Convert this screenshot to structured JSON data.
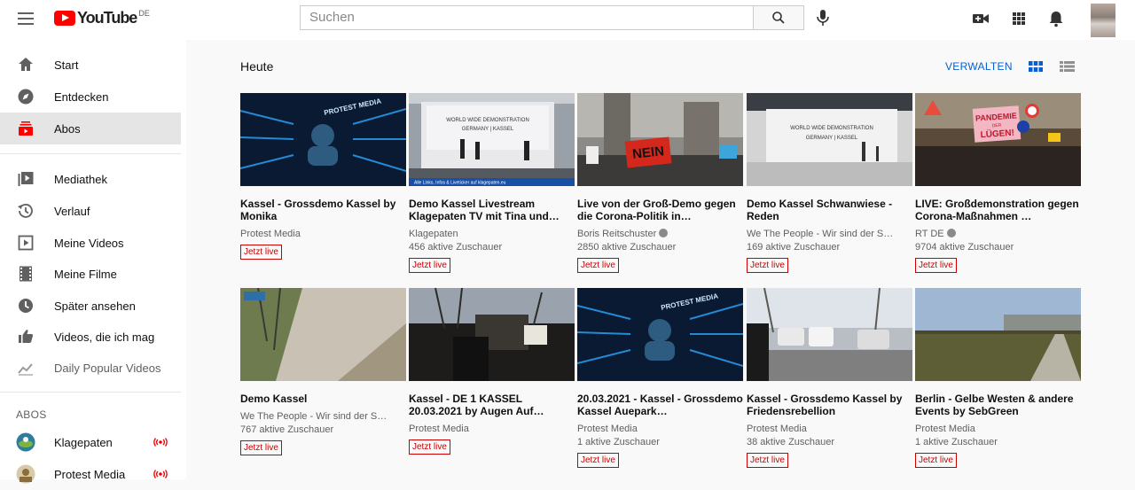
{
  "header": {
    "logo_text": "YouTube",
    "logo_country": "DE",
    "search_placeholder": "Suchen"
  },
  "sidebar": {
    "items": [
      {
        "label": "Start",
        "icon": "home-icon"
      },
      {
        "label": "Entdecken",
        "icon": "compass-icon"
      },
      {
        "label": "Abos",
        "icon": "subscriptions-icon",
        "active": true
      },
      {
        "label": "Mediathek",
        "icon": "library-icon"
      },
      {
        "label": "Verlauf",
        "icon": "history-icon"
      },
      {
        "label": "Meine Videos",
        "icon": "my-videos-icon"
      },
      {
        "label": "Meine Filme",
        "icon": "film-icon"
      },
      {
        "label": "Später ansehen",
        "icon": "watch-later-icon"
      },
      {
        "label": "Videos, die ich mag",
        "icon": "thumbs-up-icon"
      },
      {
        "label": "Daily Popular Videos",
        "icon": "trending-icon"
      }
    ],
    "abos_title": "ABOS",
    "channels": [
      {
        "name": "Klagepaten",
        "live": true
      },
      {
        "name": "Protest Media",
        "live": true
      }
    ]
  },
  "main": {
    "section_title": "Heute",
    "manage_label": "VERWALTEN",
    "live_badge": "Jetzt live",
    "videos": [
      {
        "title": "Kassel - Grossdemo Kassel by Monika",
        "channel": "Protest Media",
        "viewers": "",
        "verified": false,
        "thumb": "protest-media"
      },
      {
        "title": "Demo Kassel Livestream Klagepaten TV mit Tina und…",
        "channel": "Klagepaten",
        "viewers": "456 aktive Zuschauer",
        "verified": false,
        "thumb": "stage"
      },
      {
        "title": "Live von der Groß-Demo gegen die Corona-Politik in…",
        "channel": "Boris Reitschuster",
        "viewers": "2850 aktive Zuschauer",
        "verified": true,
        "thumb": "crowd-nein"
      },
      {
        "title": "Demo Kassel Schwanwiese - Reden",
        "channel": "We The People - Wir sind der S…",
        "viewers": "169 aktive Zuschauer",
        "verified": false,
        "thumb": "stage2"
      },
      {
        "title": "LIVE: Großdemonstration gegen Corona-Maßnahmen …",
        "channel": "RT DE",
        "viewers": "9704 aktive Zuschauer",
        "verified": true,
        "thumb": "pandemie"
      },
      {
        "title": "Demo Kassel",
        "channel": "We The People - Wir sind der S…",
        "viewers": "767 aktive Zuschauer",
        "verified": false,
        "thumb": "park"
      },
      {
        "title": "Kassel - DE 1 KASSEL 20.03.2021 by Augen Auf…",
        "channel": "Protest Media",
        "viewers": "",
        "verified": false,
        "thumb": "dark-crowd"
      },
      {
        "title": "20.03.2021 - Kassel - Grossdemo Kassel Auepark…",
        "channel": "Protest Media",
        "viewers": "1 aktive Zuschauer",
        "verified": false,
        "thumb": "protest-media"
      },
      {
        "title": "Kassel - Grossdemo Kassel by Friedensrebellion",
        "channel": "Protest Media",
        "viewers": "38 aktive Zuschauer",
        "verified": false,
        "thumb": "street-cars"
      },
      {
        "title": "Berlin - Gelbe Westen & andere Events by SebGreen",
        "channel": "Protest Media",
        "viewers": "1 aktive Zuschauer",
        "verified": false,
        "thumb": "field"
      }
    ]
  },
  "colors": {
    "brand_red": "#ff0000",
    "link_blue": "#065fd4",
    "live_red": "#cc0000"
  }
}
